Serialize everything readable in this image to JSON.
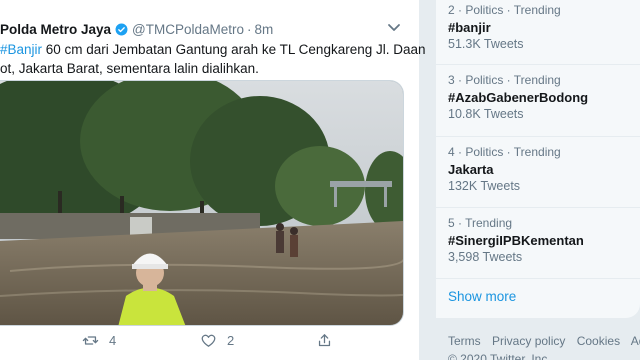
{
  "tweet": {
    "author_name": "Polda Metro Jaya",
    "handle": "@TMCPoldaMetro",
    "separator": "·",
    "time": "8m",
    "text_line1_hashtag": "#Banjir",
    "text_line1_rest": " 60 cm dari Jembatan Gantung arah ke TL Cengkareng Jl. Daan",
    "text_line2": "ot, Jakarta Barat, sementara lalin dialihkan.",
    "actions": {
      "retweets": "4",
      "likes": "2"
    }
  },
  "trends": [
    {
      "meta": "2 · Politics · Trending",
      "name": "#banjir",
      "count": "51.3K Tweets"
    },
    {
      "meta": "3 · Politics · Trending",
      "name": "#AzabGabenerBodong",
      "count": "10.8K Tweets"
    },
    {
      "meta": "4 · Politics · Trending",
      "name": "Jakarta",
      "count": "132K Tweets"
    },
    {
      "meta": "5 · Trending",
      "name": "#SinergiIPBKementan",
      "count": "3,598 Tweets"
    }
  ],
  "show_more": "Show more",
  "footer": {
    "links": [
      "Terms",
      "Privacy policy",
      "Cookies",
      "Ads in"
    ],
    "copyright": "© 2020 Twitter, Inc."
  },
  "colors": {
    "accent": "#1b95e0",
    "secondary_text": "#657786",
    "primary_text": "#14171a"
  }
}
